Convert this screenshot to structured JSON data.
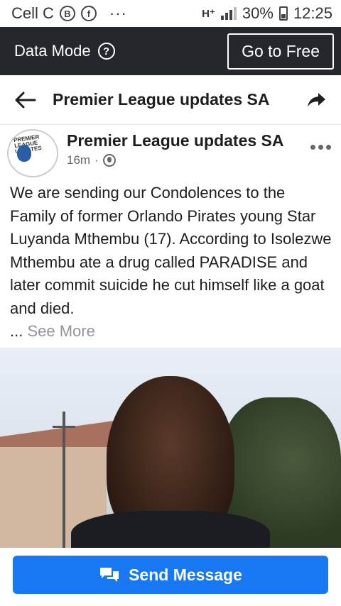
{
  "status_bar": {
    "carrier": "Cell C",
    "circle_badge": "B",
    "dots": "···",
    "network": "H⁺",
    "battery": "30%",
    "time": "12:25"
  },
  "data_bar": {
    "label": "Data Mode",
    "help": "?",
    "button": "Go to Free"
  },
  "header": {
    "title": "Premier League updates SA"
  },
  "post": {
    "avatar_text": "PREMIER LEAGUE UPDATES",
    "author": "Premier League updates SA",
    "time": "16m",
    "separator": "·",
    "body": "We are sending our Condolences to the Family of former Orlando Pirates young Star Luyanda Mthembu (17). According to Isolezwe Mthembu ate a drug called PARADISE and later commit suicide he cut himself like a goat and died.",
    "ellipsis": "...",
    "see_more": "See More"
  },
  "footer": {
    "send_label": "Send Message"
  },
  "colors": {
    "accent": "#1877f2",
    "dark_bar": "#24272c",
    "muted": "#90949c"
  }
}
